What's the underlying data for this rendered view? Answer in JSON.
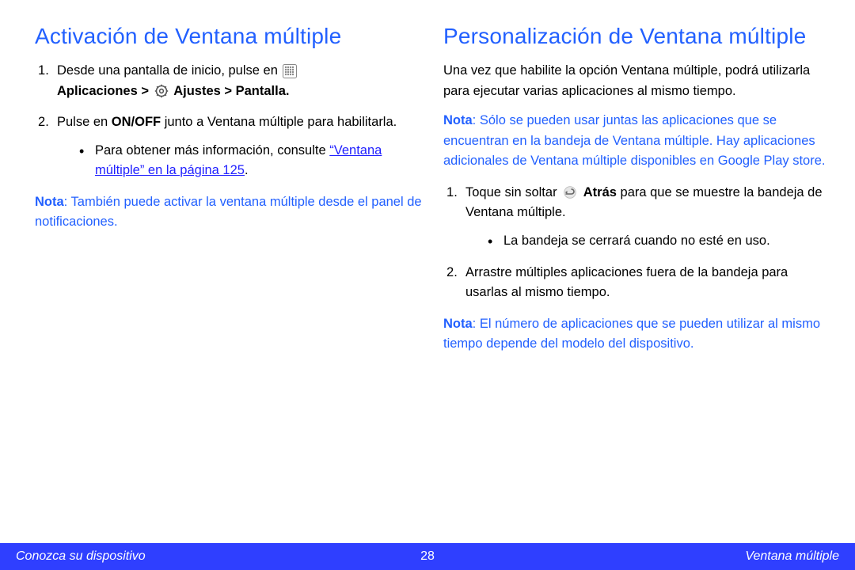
{
  "left": {
    "heading": "Activación de Ventana múltiple",
    "step1_pre": "Desde una pantalla de inicio, pulse en ",
    "step1_bold": "Aplicaciones > ",
    "step1_bold2": " Ajustes > Pantalla.",
    "step2_a": "Pulse en ",
    "step2_b": "ON/OFF",
    "step2_c": " junto a Ventana múltiple para habilitarla.",
    "sub_pre": "Para obtener más información, consulte ",
    "sub_link": "“Ventana múltiple” en la página 125",
    "sub_post": ".",
    "note_label": "Nota",
    "note_body": ": También puede activar la ventana múltiple desde el panel de notificaciones."
  },
  "right": {
    "heading": "Personalización de Ventana múltiple",
    "intro": "Una vez que habilite la opción Ventana múltiple, podrá utilizarla para ejecutar varias aplicaciones al mismo tiempo.",
    "note1_label": "Nota",
    "note1_body": ": Sólo se pueden usar juntas las aplicaciones que se encuentran en la bandeja de Ventana múltiple. Hay aplicaciones adicionales de Ventana múltiple disponibles en Google Play store.",
    "step1_a": "Toque sin soltar ",
    "step1_b": " Atrás",
    "step1_c": " para que se muestre la bandeja de Ventana múltiple.",
    "sub1": "La bandeja se cerrará cuando no esté en uso.",
    "step2": "Arrastre múltiples aplicaciones fuera de la bandeja para usarlas al mismo tiempo.",
    "note2_label": "Nota",
    "note2_body": ": El número de aplicaciones que se pueden utilizar al mismo tiempo depende del modelo del dispositivo."
  },
  "footer": {
    "left": "Conozca su dispositivo",
    "page": "28",
    "right": "Ventana múltiple"
  }
}
